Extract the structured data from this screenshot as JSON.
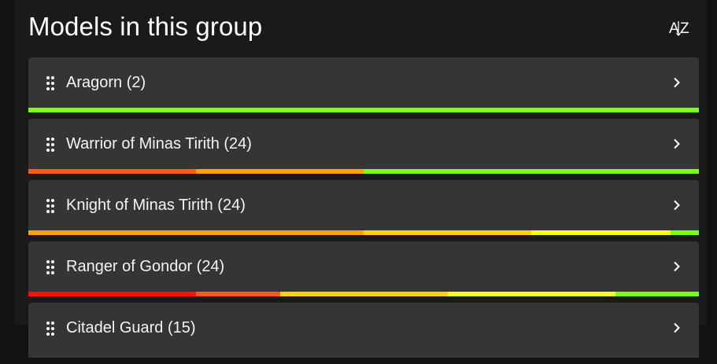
{
  "header": {
    "title": "Models in this group",
    "sort_icon": "sort-alpha-icon"
  },
  "colors": {
    "background": "#121212",
    "card": "#353535",
    "red": "#ff1200",
    "orange_red": "#ff5a14",
    "orange": "#ffa014",
    "yellow_orange": "#ffcf14",
    "yellow": "#f6ff1a",
    "green": "#7bff14"
  },
  "models": [
    {
      "label": "Aragorn (2)",
      "progress": [
        {
          "color": "#7bff14",
          "fraction": 1.0
        }
      ]
    },
    {
      "label": "Warrior of Minas Tirith (24)",
      "progress": [
        {
          "color": "#ff5a14",
          "fraction": 0.25
        },
        {
          "color": "#ffa014",
          "fraction": 0.25
        },
        {
          "color": "#7bff14",
          "fraction": 0.5
        }
      ]
    },
    {
      "label": "Knight of Minas Tirith (24)",
      "progress": [
        {
          "color": "#ffa014",
          "fraction": 0.5
        },
        {
          "color": "#ffcf14",
          "fraction": 0.25
        },
        {
          "color": "#f6ff1a",
          "fraction": 0.2083
        },
        {
          "color": "#7bff14",
          "fraction": 0.0417
        }
      ]
    },
    {
      "label": "Ranger of Gondor (24)",
      "progress": [
        {
          "color": "#ff1200",
          "fraction": 0.25
        },
        {
          "color": "#ff5a14",
          "fraction": 0.125
        },
        {
          "color": "#ffcf14",
          "fraction": 0.25
        },
        {
          "color": "#f6ff1a",
          "fraction": 0.25
        },
        {
          "color": "#7bff14",
          "fraction": 0.125
        }
      ]
    },
    {
      "label": "Citadel Guard (15)",
      "progress": []
    }
  ]
}
